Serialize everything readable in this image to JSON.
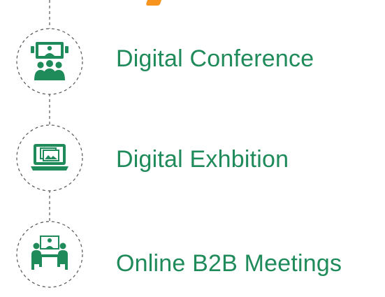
{
  "colors": {
    "brand_green": "#1f8a5a",
    "accent_orange": "#f7941d",
    "connector_gray": "#555555"
  },
  "items": [
    {
      "label": "Digital Conference",
      "icon": "video-conference-icon"
    },
    {
      "label": "Digital Exhbition",
      "icon": "monitor-gallery-icon"
    },
    {
      "label": "Online B2B Meetings",
      "icon": "meeting-table-icon"
    }
  ]
}
